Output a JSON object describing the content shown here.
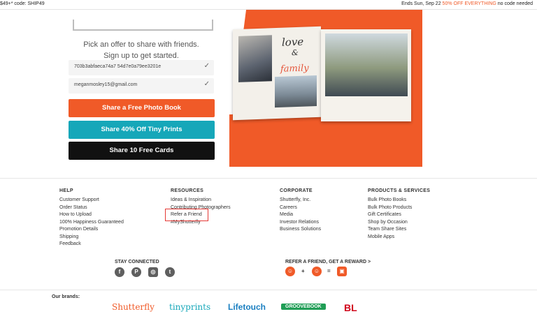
{
  "topbar": {
    "left_text": "$49+* code: SHIP49",
    "right_prefix": "Ends Sun, Sep 22",
    "right_accent": "50% OFF EVERYTHING",
    "right_suffix": "no code needed"
  },
  "hero": {
    "pitch_line1": "Pick an offer to share with friends.",
    "pitch_line2": "Sign up to get started.",
    "field_code": "703b3abfaeca74a7 54d7e0a79ee3201e",
    "field_email": "meganmosley15@gmail.com",
    "cta_photo_book": "Share a Free Photo Book",
    "cta_tiny_prints": "Share 40% Off Tiny Prints",
    "cta_cards": "Share 10 Free Cards",
    "book_text_love": "love",
    "book_text_amp": "&",
    "book_text_family": "family"
  },
  "footer": {
    "help": {
      "heading": "HELP",
      "links": [
        "Customer Support",
        "Order Status",
        "How to Upload",
        "100% Happiness Guaranteed",
        "Promotion Details",
        "Shipping",
        "Feedback"
      ]
    },
    "resources": {
      "heading": "RESOURCES",
      "links": [
        "Ideas & Inspiration",
        "Contributing Photographers",
        "Refer a Friend",
        "#MyShutterfly"
      ]
    },
    "corporate": {
      "heading": "CORPORATE",
      "links": [
        "Shutterfly, Inc.",
        "Careers",
        "Media",
        "Investor Relations",
        "Business Solutions"
      ]
    },
    "products": {
      "heading": "PRODUCTS & SERVICES",
      "links": [
        "Bulk Photo Books",
        "Bulk Photo Products",
        "Gift Certificates",
        "Shop by Occasion",
        "Team Share Sites",
        "Mobile Apps"
      ]
    },
    "stay_connected": "STAY CONNECTED",
    "refer_reward": "REFER A FRIEND, GET A REWARD >",
    "op_plus": "+",
    "op_equals": "=",
    "brands_label": "Our brands:",
    "brands": [
      "Shutterfly",
      "tinyprints",
      "Lifetouch",
      "GROOVEBOOK",
      "BL"
    ]
  },
  "colors": {
    "accent_orange": "#f05a28",
    "teal": "#16a7b9",
    "highlight_red": "#e53935"
  }
}
